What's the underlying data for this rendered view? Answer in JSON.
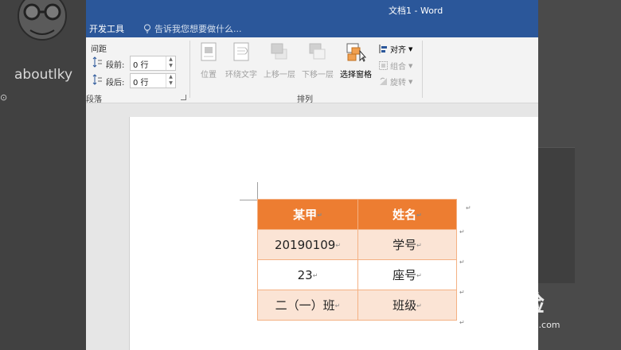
{
  "desktop": {
    "name": "aboutlky"
  },
  "window": {
    "title": "文档1 - Word"
  },
  "tabs": {
    "developer": "开发工具"
  },
  "tellme": {
    "placeholder": "告诉我您想要做什么..."
  },
  "paragraph": {
    "spacing_heading": "间距",
    "before_label": "段前:",
    "before_value": "0 行",
    "after_label": "段后:",
    "after_value": "0 行",
    "group_label": "段落"
  },
  "arrange": {
    "position": "位置",
    "wrap_text": "环绕文字",
    "bring_forward": "上移一层",
    "send_backward": "下移一层",
    "selection_pane": "选择窗格",
    "align": "对齐",
    "group": "组合",
    "rotate": "旋转",
    "group_label": "排列"
  },
  "table": {
    "header": [
      "某甲",
      "姓名"
    ],
    "rows": [
      [
        "20190109",
        "学号"
      ],
      [
        "23",
        "座号"
      ],
      [
        "二（一）班",
        "班级"
      ]
    ]
  },
  "watermark": {
    "logo": "Bai经验",
    "url": "jingyan.baidu.com"
  },
  "colors": {
    "word_blue": "#2b579a",
    "table_header": "#ed7d31",
    "table_shade": "#fbe4d5",
    "table_border": "#f4b183"
  }
}
